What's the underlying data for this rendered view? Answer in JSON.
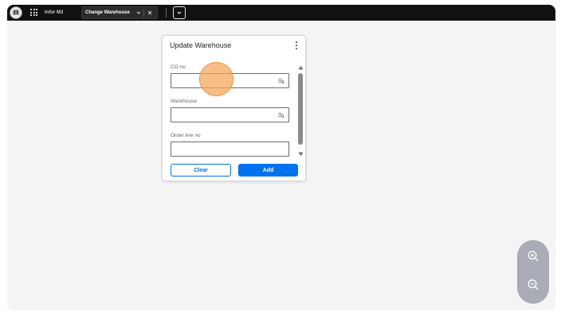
{
  "topbar": {
    "app_title": "Infor M3",
    "active_tab": "Change Warehouse",
    "logo_icon": "infor-logo-icon",
    "menu_icon": "waffle-grid-icon"
  },
  "dialog": {
    "title": "Update Warehouse",
    "fields": [
      {
        "label": "CO no",
        "value": "",
        "has_lookup": true
      },
      {
        "label": "Warehouse",
        "value": "",
        "has_lookup": true
      },
      {
        "label": "Order line no",
        "value": "",
        "has_lookup": false
      }
    ],
    "buttons": {
      "clear": "Clear",
      "add": "Add"
    }
  },
  "colors": {
    "accent": "#0072ed",
    "topbar": "#111111",
    "canvas": "#f4f4f4",
    "cursor_highlight": "#f7a85c",
    "zoom_panel": "#a9acb6"
  },
  "zoom": {
    "in_icon": "zoom-in-icon",
    "out_icon": "zoom-out-icon"
  }
}
